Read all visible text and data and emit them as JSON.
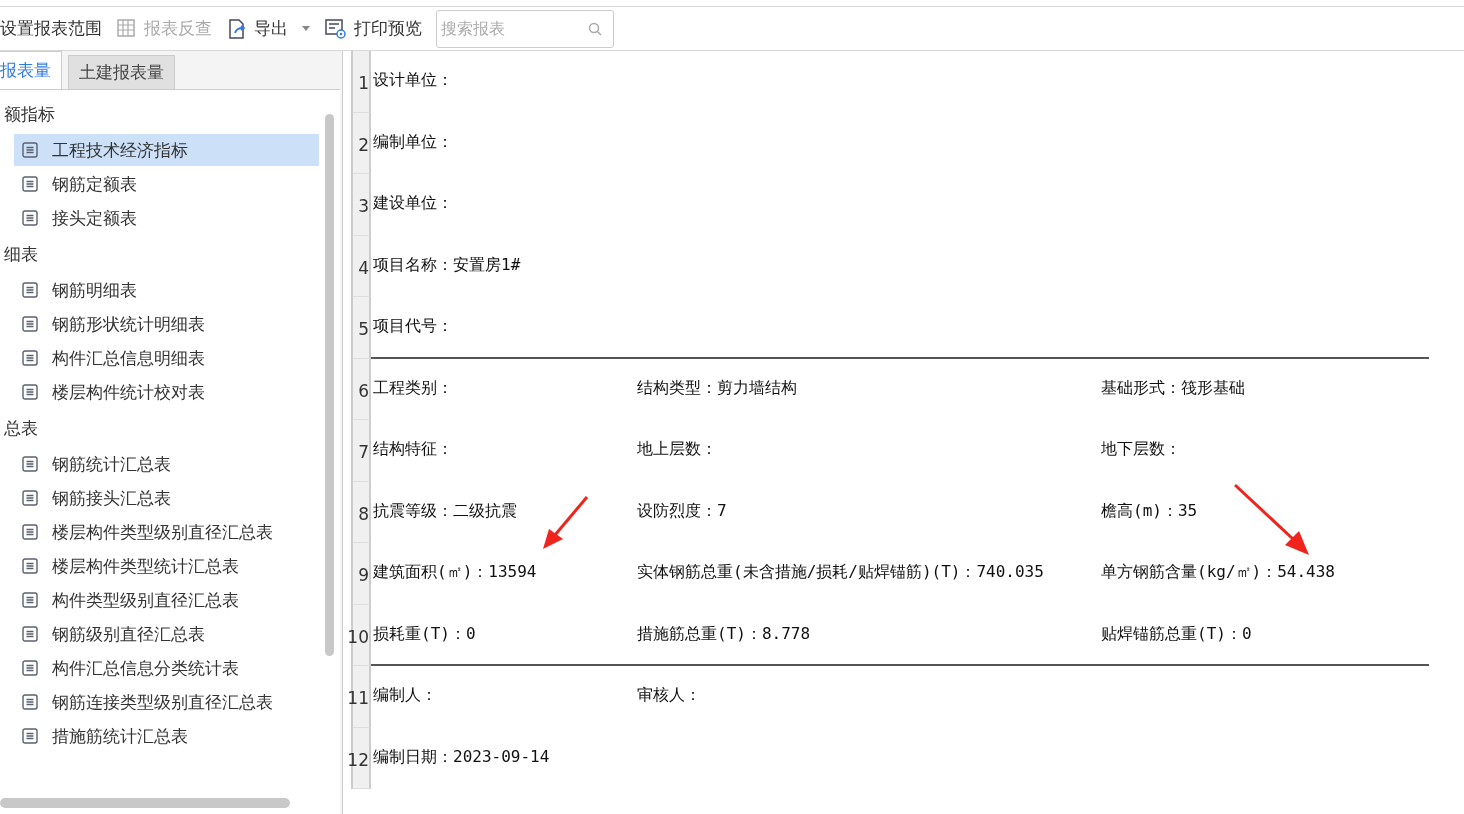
{
  "toolbar": [
    {
      "kind": "text",
      "label": "设置报表范围",
      "disabled": false
    },
    {
      "kind": "grid",
      "label": "报表反查",
      "disabled": true
    },
    {
      "kind": "export",
      "label": "导出",
      "disabled": false,
      "dropdown": true
    },
    {
      "kind": "print",
      "label": "打印预览",
      "disabled": false
    }
  ],
  "search": {
    "placeholder": "搜索报表"
  },
  "tabs": [
    {
      "label": "报表量",
      "selected": true
    },
    {
      "label": "土建报表量",
      "selected": false
    }
  ],
  "tree": [
    {
      "label": "额指标",
      "children": [
        {
          "label": "工程技术经济指标",
          "selected": true
        },
        {
          "label": "钢筋定额表",
          "selected": false
        },
        {
          "label": "接头定额表",
          "selected": false
        }
      ]
    },
    {
      "label": "细表",
      "children": [
        {
          "label": "钢筋明细表",
          "selected": false
        },
        {
          "label": "钢筋形状统计明细表",
          "selected": false
        },
        {
          "label": "构件汇总信息明细表",
          "selected": false
        },
        {
          "label": "楼层构件统计校对表",
          "selected": false
        }
      ]
    },
    {
      "label": "总表",
      "children": [
        {
          "label": "钢筋统计汇总表",
          "selected": false
        },
        {
          "label": "钢筋接头汇总表",
          "selected": false
        },
        {
          "label": "楼层构件类型级别直径汇总表",
          "selected": false
        },
        {
          "label": "楼层构件类型统计汇总表",
          "selected": false
        },
        {
          "label": "构件类型级别直径汇总表",
          "selected": false
        },
        {
          "label": "钢筋级别直径汇总表",
          "selected": false
        },
        {
          "label": "构件汇总信息分类统计表",
          "selected": false
        },
        {
          "label": "钢筋连接类型级别直径汇总表",
          "selected": false
        },
        {
          "label": "措施筋统计汇总表",
          "selected": false
        }
      ]
    }
  ],
  "report": {
    "rows": [
      {
        "number": "1",
        "cells": [
          "设计单位："
        ],
        "rule_below": false
      },
      {
        "number": "2",
        "cells": [
          "编制单位："
        ],
        "rule_below": false
      },
      {
        "number": "3",
        "cells": [
          "建设单位："
        ],
        "rule_below": false
      },
      {
        "number": "4",
        "cells": [
          "项目名称：安置房1#"
        ],
        "rule_below": false
      },
      {
        "number": "5",
        "cells": [
          "项目代号："
        ],
        "rule_below": true
      },
      {
        "number": "6",
        "cells": [
          "工程类别：",
          "结构类型：剪力墙结构",
          "基础形式：筏形基础"
        ],
        "rule_below": false
      },
      {
        "number": "7",
        "cells": [
          "结构特征：",
          "地上层数：",
          "地下层数："
        ],
        "rule_below": false
      },
      {
        "number": "8",
        "cells": [
          "抗震等级：二级抗震",
          "设防烈度：7",
          "檐高(m)：35"
        ],
        "rule_below": false
      },
      {
        "number": "9",
        "cells": [
          "建筑面积(㎡)：13594",
          "实体钢筋总重(未含措施/损耗/贴焊锚筋)(T)：740.035",
          "单方钢筋含量(kg/㎡)：54.438"
        ],
        "rule_below": false
      },
      {
        "number": "10",
        "cells": [
          "损耗重(T)：0",
          "措施筋总重(T)：8.778",
          "贴焊锚筋总重(T)：0"
        ],
        "rule_below": true
      },
      {
        "number": "11",
        "cells": [
          "编制人：",
          "审核人："
        ],
        "rule_below": false
      },
      {
        "number": "12",
        "cells": [
          "编制日期：2023-09-14"
        ],
        "rule_below": false
      }
    ]
  }
}
